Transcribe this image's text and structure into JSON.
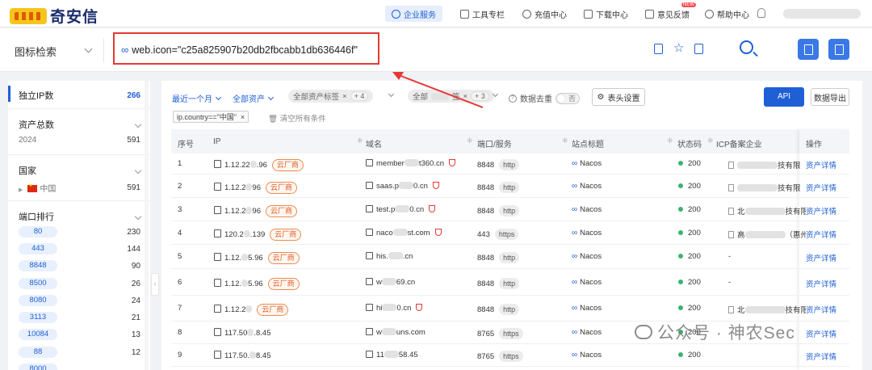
{
  "brand": {
    "logo_text": "奇安信"
  },
  "topnav": {
    "items": [
      {
        "label": "企业服务",
        "icon": "enterprise-icon",
        "active": true
      },
      {
        "label": "工具专栏",
        "icon": "toolbox-icon"
      },
      {
        "label": "充值中心",
        "icon": "recharge-icon"
      },
      {
        "label": "下载中心",
        "icon": "download-icon"
      },
      {
        "label": "意见反馈",
        "icon": "feedback-icon",
        "badge": "NEW"
      },
      {
        "label": "帮助中心",
        "icon": "help-icon"
      }
    ]
  },
  "search": {
    "type_label": "图标检索",
    "query": "web.icon=\"c25a825907b20db2fbcabb1db636446f\""
  },
  "left_panel": {
    "independent_ip": {
      "label": "独立IP数",
      "count": "266"
    },
    "asset_total": {
      "label": "资产总数",
      "year": "2024",
      "count": "591"
    },
    "country": {
      "label": "国家",
      "items": [
        {
          "name": "中国",
          "count": "591"
        }
      ]
    },
    "port_rank": {
      "label": "端口排行",
      "items": [
        {
          "port": "80",
          "count": "230"
        },
        {
          "port": "443",
          "count": "144"
        },
        {
          "port": "8848",
          "count": "90"
        },
        {
          "port": "8500",
          "count": "26"
        },
        {
          "port": "8080",
          "count": "24"
        },
        {
          "port": "3113",
          "count": "21"
        },
        {
          "port": "10084",
          "count": "13"
        },
        {
          "port": "88",
          "count": "12"
        },
        {
          "port": "8000",
          "count": ""
        }
      ]
    }
  },
  "filters": {
    "time": "最近一个月",
    "assets": "全部资产",
    "asset_tags": "全部资产标签",
    "asset_tags_count": "+ 4",
    "system_tags": "全部",
    "system_tags_suffix": "签",
    "system_tags_count": "+ 3",
    "dedup_label": "数据去重",
    "dedup_value": "否",
    "header_settings": "表头设置",
    "api": "API",
    "export": "数据导出",
    "condition": "ip.country==\"中国\"",
    "clear_all": "清空所有条件"
  },
  "table": {
    "headers": [
      "序号",
      "IP",
      "域名",
      "端口/服务",
      "站点标题",
      "状态码",
      "ICP备案企业",
      "操作"
    ],
    "rows": [
      {
        "no": "1",
        "ip_a": "1.12.22",
        "ip_b": ".96",
        "cloud": "云厂商",
        "domain_a": "member",
        "domain_b": "t360.cn",
        "shield": true,
        "port": "8848",
        "proto": "http",
        "title": "Nacos",
        "status": "200",
        "icp_end": "技有限",
        "action": "资产详情"
      },
      {
        "no": "2",
        "ip_a": "1.12.2",
        "ip_b": "96",
        "cloud": "云厂商",
        "domain_a": "saas.p",
        "domain_b": "0.cn",
        "shield": true,
        "port": "8848",
        "proto": "http",
        "title": "Nacos",
        "status": "200",
        "icp_end": "技有限",
        "action": "资产详情"
      },
      {
        "no": "3",
        "ip_a": "1.12.2",
        "ip_b": "96",
        "cloud": "云厂商",
        "domain_a": "test.p",
        "domain_b": "0.cn",
        "shield": true,
        "port": "8848",
        "proto": "http",
        "title": "Nacos",
        "status": "200",
        "icp_start": "北",
        "icp_end": "技有限",
        "action": "资产详情"
      },
      {
        "no": "4",
        "ip_a": "120.2",
        "ip_b": ".139",
        "cloud": "云厂商",
        "domain_a": "naco",
        "domain_b": "st.com",
        "shield": true,
        "port": "443",
        "proto": "https",
        "title": "Nacos",
        "status": "200",
        "icp_start": "高",
        "icp_end": "（惠州）有",
        "action": "资产详情"
      },
      {
        "no": "5",
        "ip_a": "1.12.",
        "ip_b": "5.96",
        "cloud": "云厂商",
        "domain_a": "his.",
        "domain_b": ".cn",
        "shield": false,
        "port": "8848",
        "proto": "http",
        "title": "Nacos",
        "status": "200",
        "icp_plain": "-",
        "action": "资产详情"
      },
      {
        "no": "6",
        "ip_a": "1.12.",
        "ip_b": "5.96",
        "cloud": "云厂商",
        "domain_a": "w",
        "domain_b": "69.cn",
        "shield": false,
        "port": "8848",
        "proto": "http",
        "title": "Nacos",
        "status": "200",
        "icp_plain": "-",
        "action": "资产详情"
      },
      {
        "no": "7",
        "ip_a": "1.12.2",
        "ip_b": "",
        "cloud": "云厂商",
        "domain_a": "hi",
        "domain_b": "0.cn",
        "shield": true,
        "port": "8848",
        "proto": "http",
        "title": "Nacos",
        "status": "200",
        "icp_start": "北",
        "icp_end": "技有限",
        "action": "资产详情"
      },
      {
        "no": "8",
        "ip_a": "117.50",
        "ip_b": ".8.45",
        "cloud": "",
        "domain_a": "w",
        "domain_b": "uns.com",
        "shield": false,
        "port": "8765",
        "proto": "https",
        "title": "Nacos",
        "status": "200",
        "icp_plain": "",
        "action": "资产详情"
      },
      {
        "no": "9",
        "ip_a": "117.50.",
        "ip_b": "8.45",
        "cloud": "",
        "domain_a": "11",
        "domain_b": "58.45",
        "shield": false,
        "port": "8765",
        "proto": "https",
        "title": "Nacos",
        "status": "200",
        "icp_plain": "",
        "action": "资产详情"
      }
    ]
  },
  "watermark": {
    "text": "公众号 · 神农Sec"
  },
  "colors": {
    "primary": "#1f5fd6",
    "highlight_box": "#e53935",
    "cloud_badge": "#f08a50",
    "status_ok": "#3cb371"
  }
}
